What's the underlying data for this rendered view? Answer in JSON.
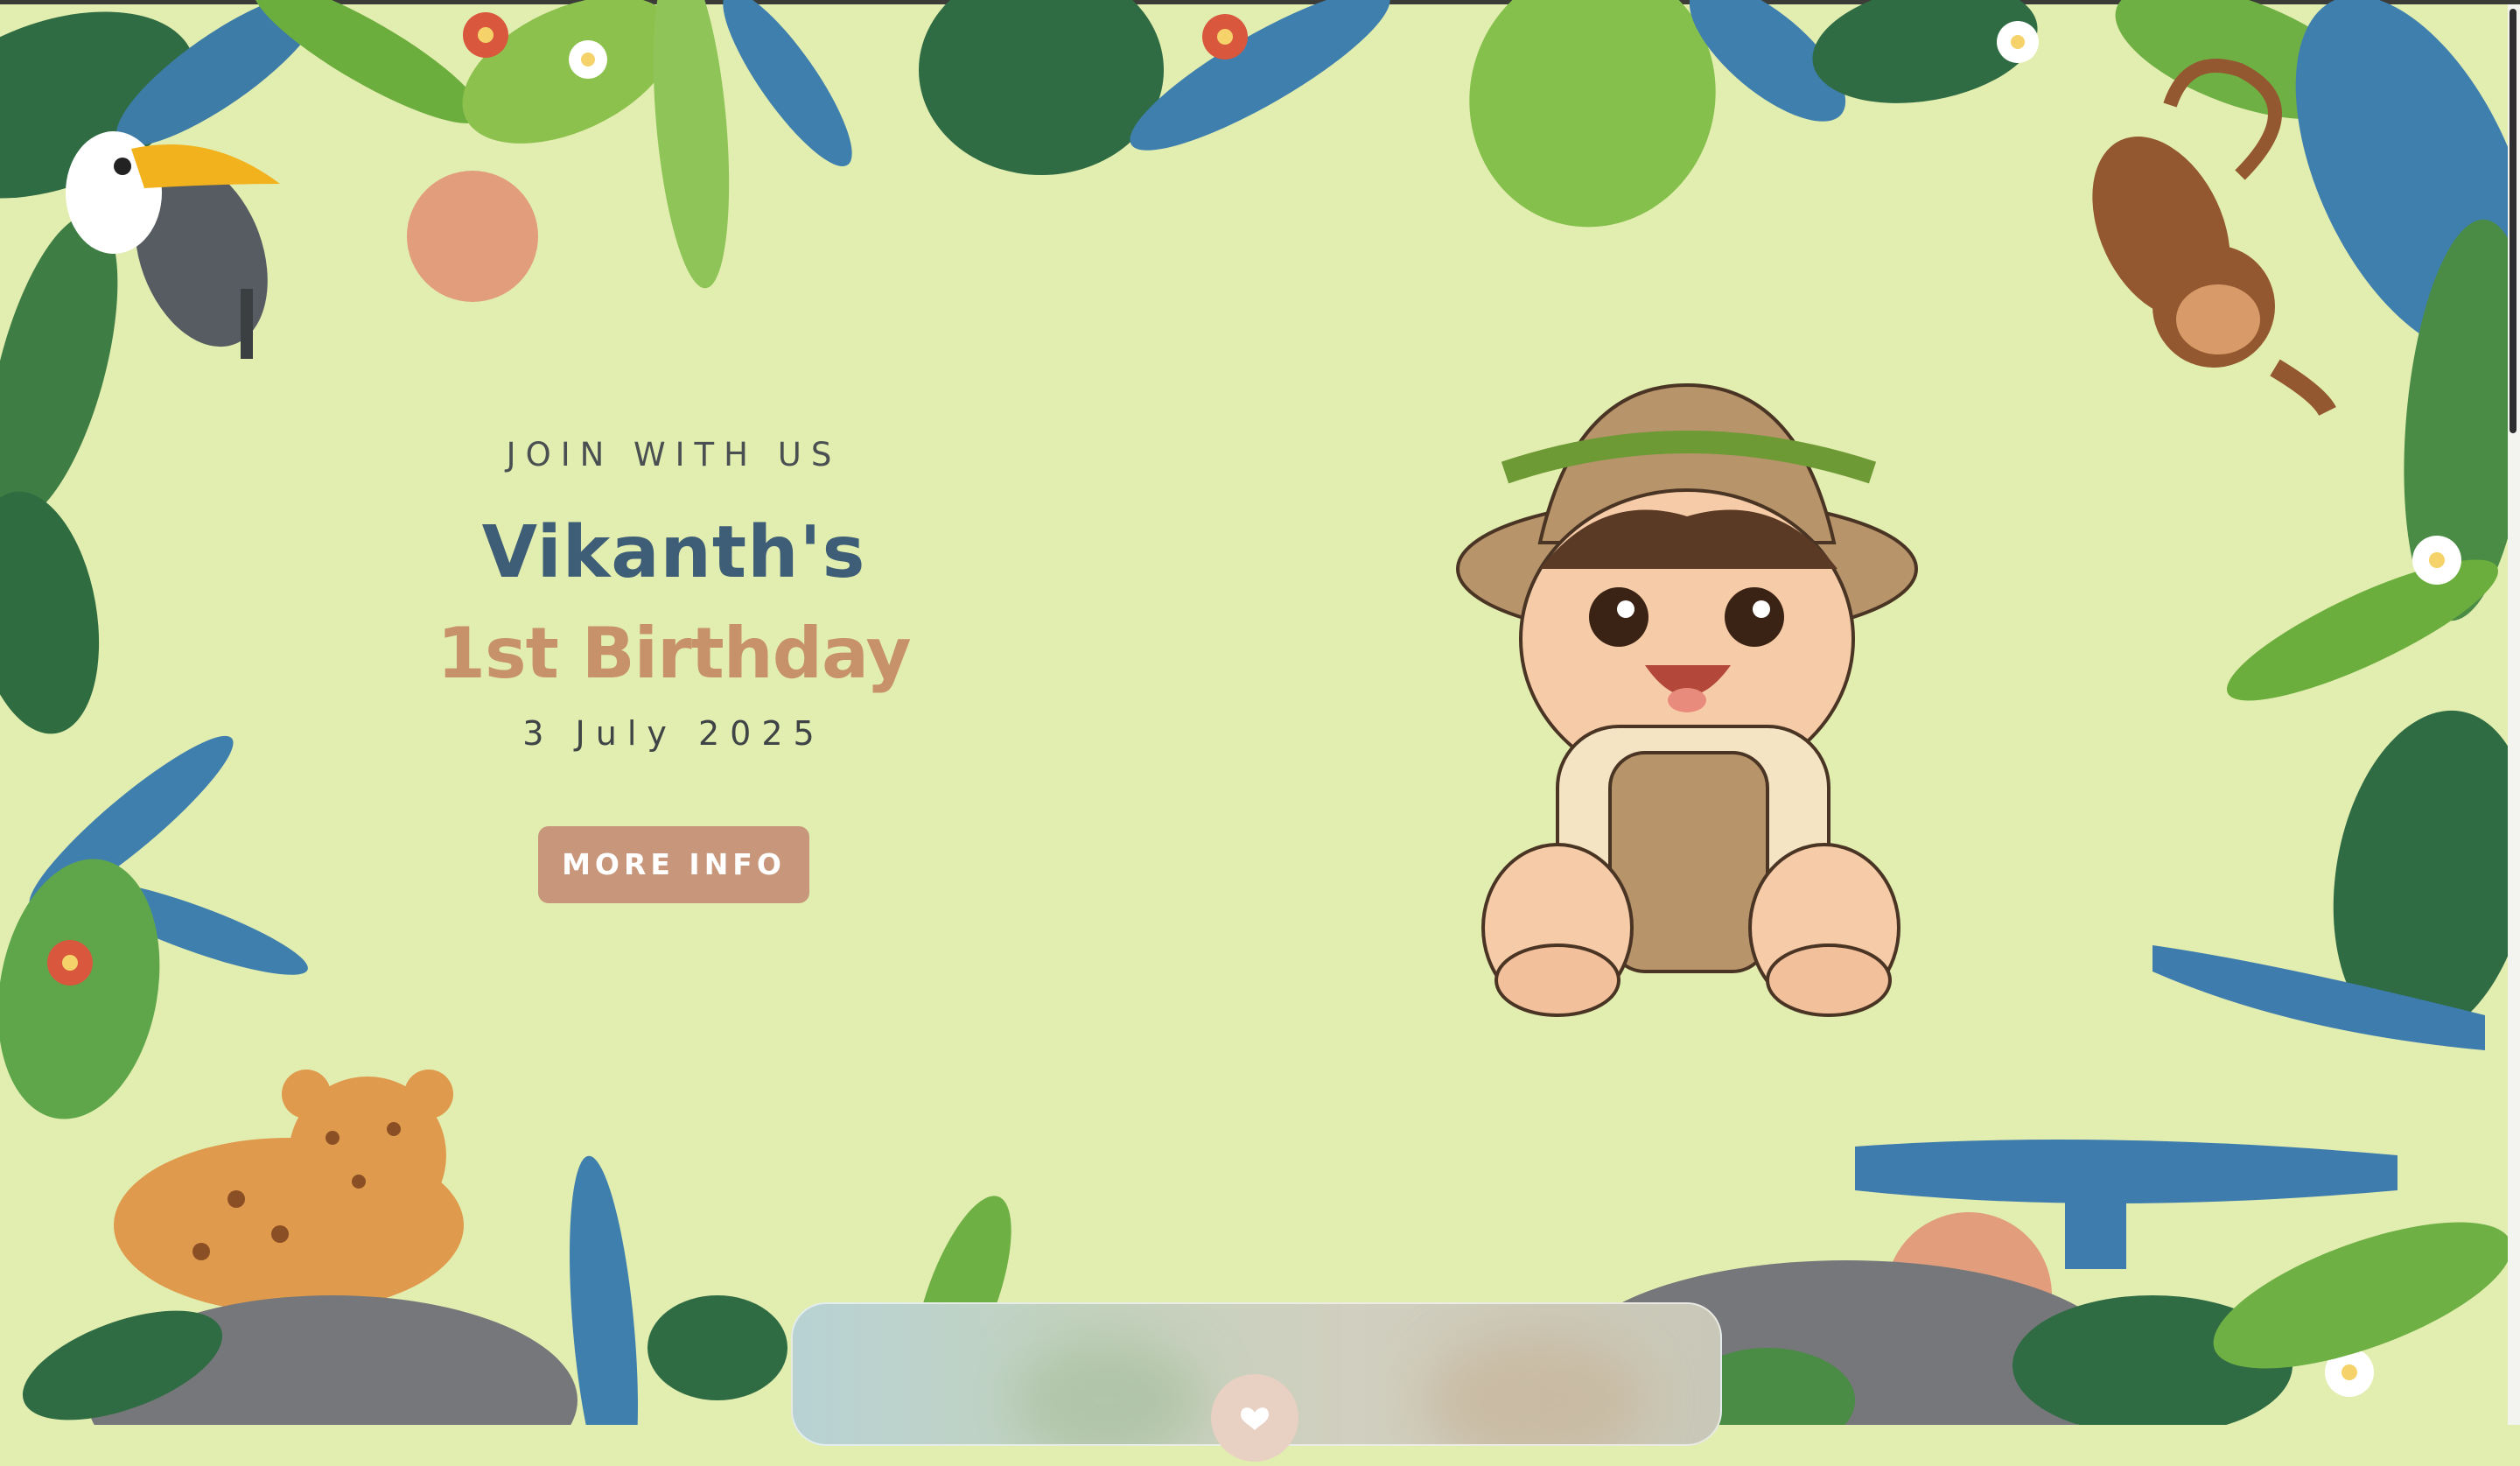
{
  "invite": {
    "eyebrow": "JOIN WITH US",
    "name": "Vikanth's",
    "occasion": "1st Birthday",
    "date": "3 July 2025",
    "button_label": "MORE INFO"
  },
  "colors": {
    "background": "#e2edb0",
    "name": "#3d5e76",
    "occasion": "#c7926a",
    "button": "#c8967a"
  },
  "icons": {
    "music_toggle": "heart-icon"
  }
}
